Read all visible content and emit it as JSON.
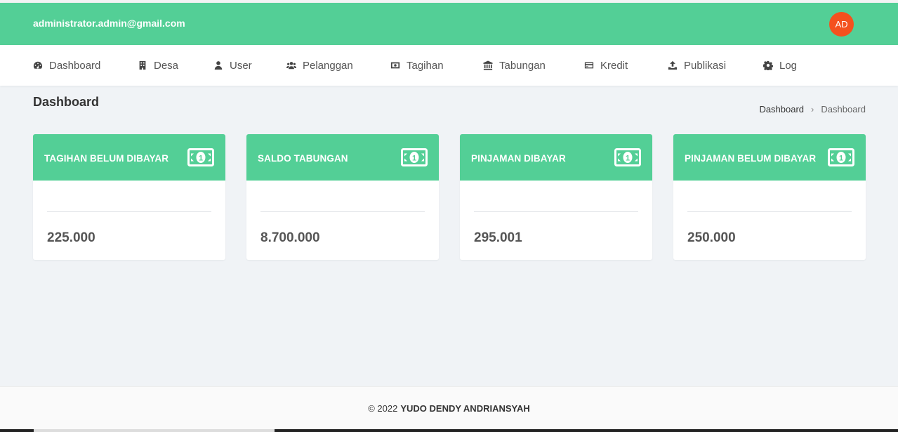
{
  "header": {
    "email": "administrator.admin@gmail.com",
    "avatar_initials": "AD",
    "brand_color": "#53cf96",
    "avatar_color": "#f4511e"
  },
  "nav": {
    "items": [
      {
        "label": "Dashboard",
        "icon": "tachometer-icon"
      },
      {
        "label": "Desa",
        "icon": "building-icon"
      },
      {
        "label": "User",
        "icon": "user-icon"
      },
      {
        "label": "Pelanggan",
        "icon": "users-icon"
      },
      {
        "label": "Tagihan",
        "icon": "money-icon"
      },
      {
        "label": "Tabungan",
        "icon": "bank-icon"
      },
      {
        "label": "Kredit",
        "icon": "credit-card-icon"
      },
      {
        "label": "Publikasi",
        "icon": "upload-icon"
      },
      {
        "label": "Log",
        "icon": "gear-icon"
      }
    ]
  },
  "page": {
    "title": "Dashboard",
    "breadcrumb": [
      "Dashboard",
      "Dashboard"
    ],
    "breadcrumb_separator": "›"
  },
  "cards": [
    {
      "title": "TAGIHAN BELUM DIBAYAR",
      "value": "225.000",
      "icon": "money-bill-icon"
    },
    {
      "title": "SALDO TABUNGAN",
      "value": "8.700.000",
      "icon": "money-bill-icon"
    },
    {
      "title": "PINJAMAN DIBAYAR",
      "value": "295.001",
      "icon": "money-bill-icon"
    },
    {
      "title": "PINJAMAN BELUM DIBAYAR",
      "value": "250.000",
      "icon": "money-bill-icon"
    }
  ],
  "footer": {
    "copyright": "© 2022",
    "author": "YUDO DENDY ANDRIANSYAH"
  }
}
